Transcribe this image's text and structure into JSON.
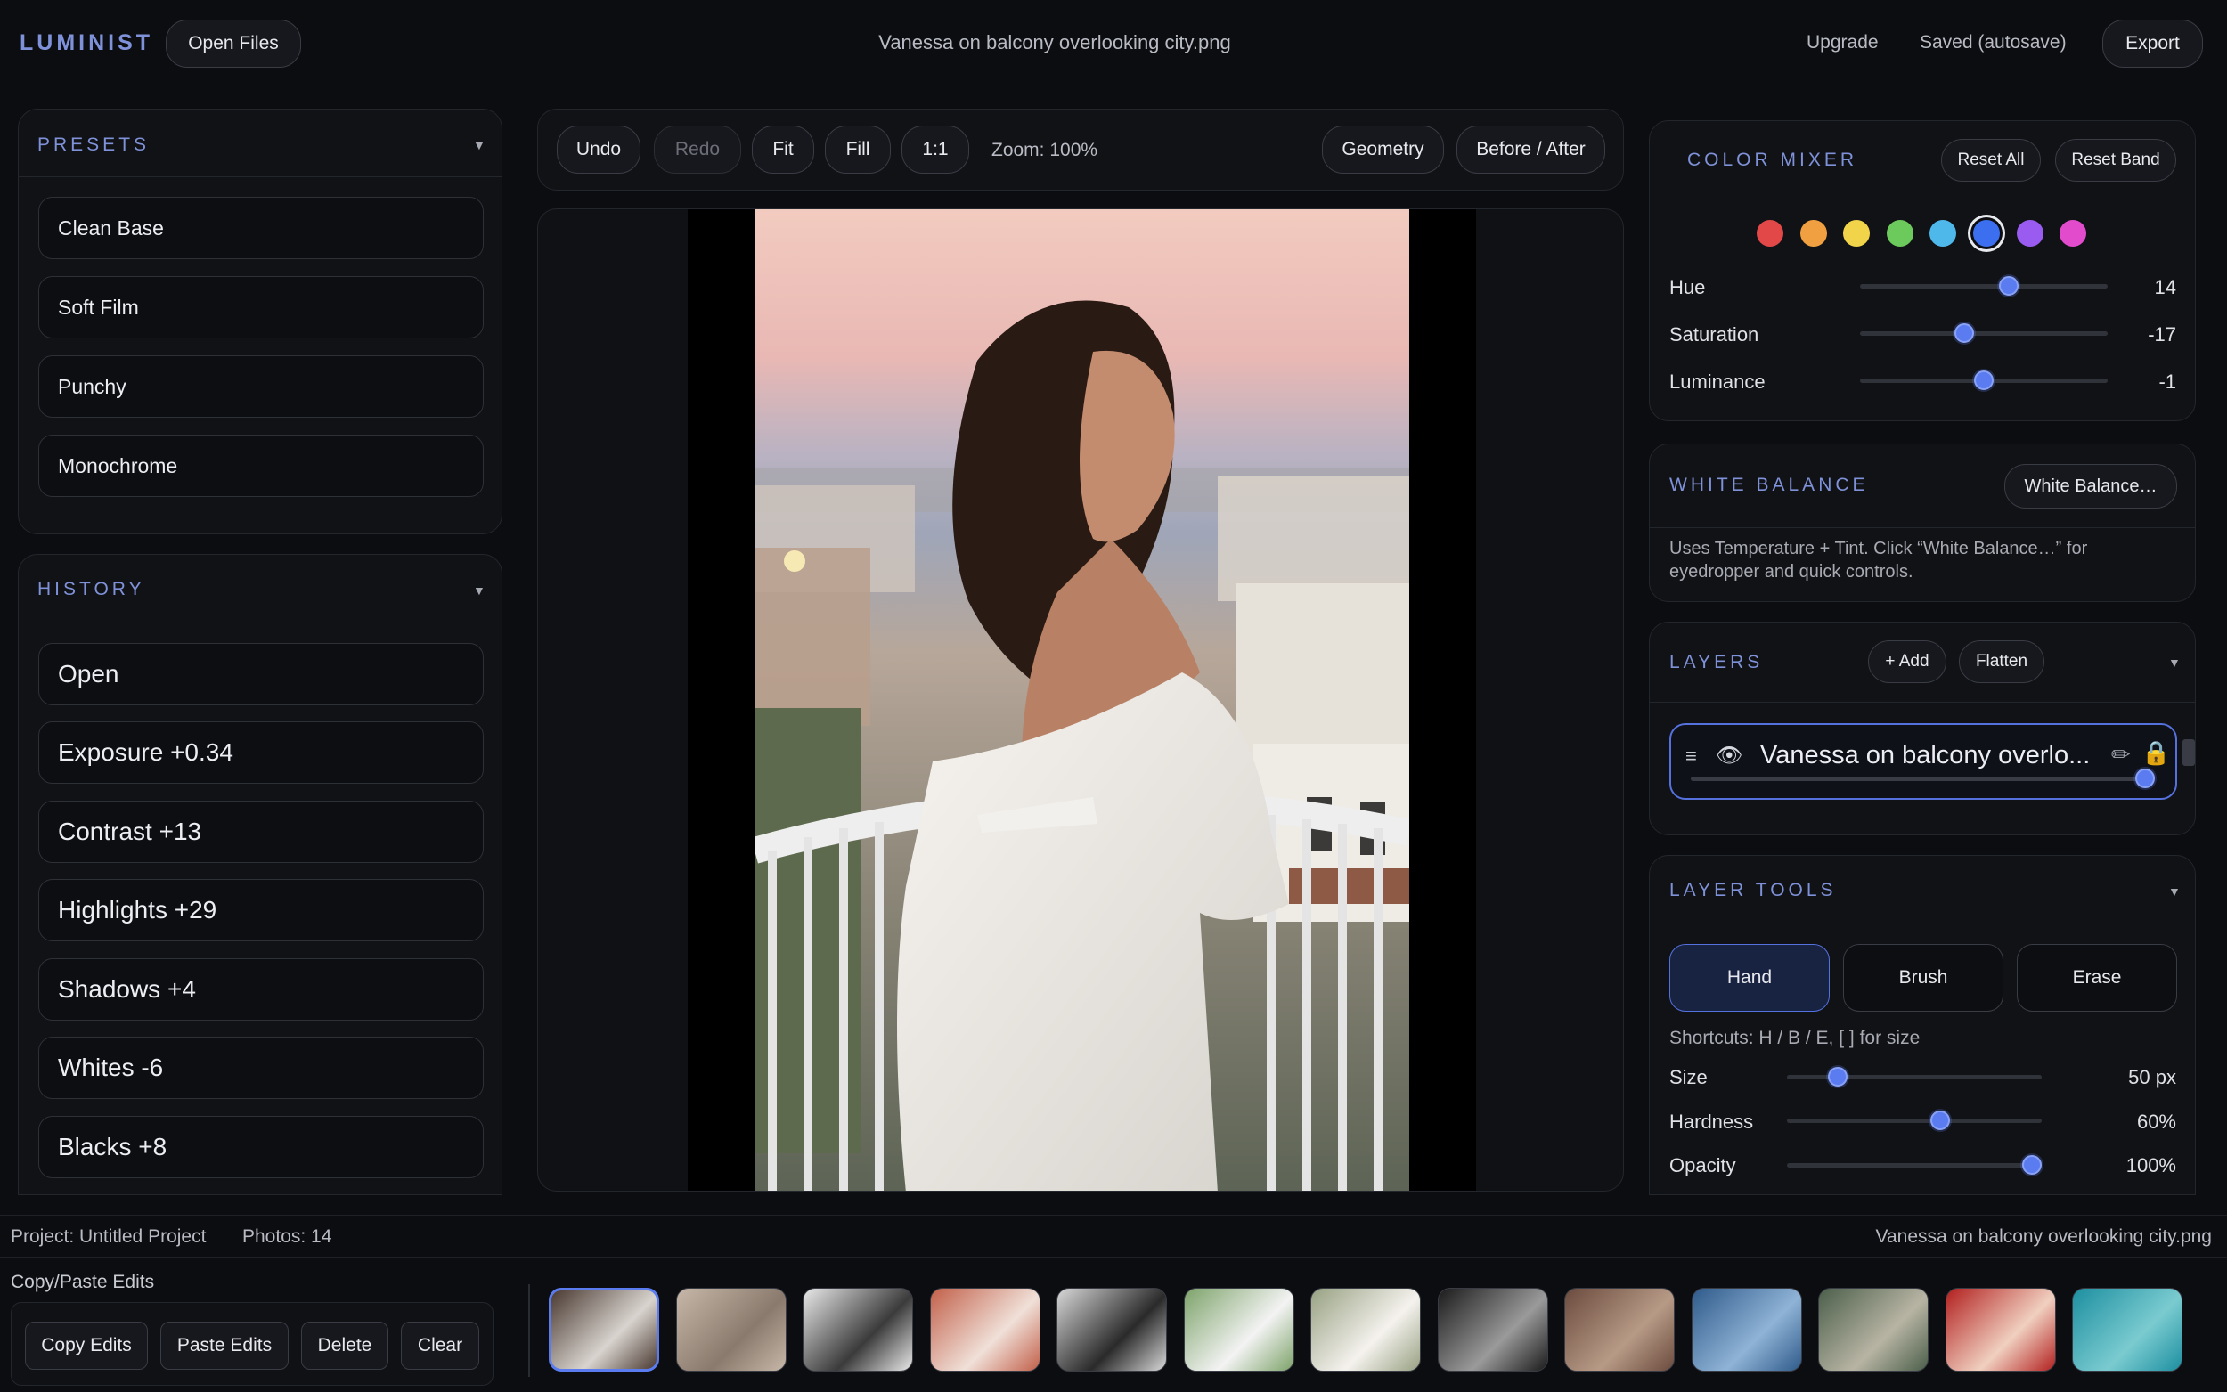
{
  "app": {
    "name": "LUMINIST",
    "open_files": "Open Files",
    "file_title": "Vanessa on balcony overlooking city.png",
    "upgrade": "Upgrade",
    "saved_status": "Saved (autosave)",
    "export": "Export"
  },
  "presets": {
    "title": "PRESETS",
    "items": [
      "Clean Base",
      "Soft Film",
      "Punchy",
      "Monochrome"
    ]
  },
  "history": {
    "title": "HISTORY",
    "items": [
      "Open",
      "Exposure +0.34",
      "Contrast +13",
      "Highlights +29",
      "Shadows +4",
      "Whites -6",
      "Blacks +8"
    ]
  },
  "toolbar": {
    "undo": "Undo",
    "redo": "Redo",
    "fit": "Fit",
    "fill": "Fill",
    "one_to_one": "1:1",
    "zoom": "Zoom: 100%",
    "geometry": "Geometry",
    "before_after": "Before / After"
  },
  "color_mixer": {
    "title": "COLOR MIXER",
    "reset_all": "Reset All",
    "reset_band": "Reset Band",
    "swatches": [
      "#e24848",
      "#f0a040",
      "#f2d44a",
      "#6cc95c",
      "#4fb8ea",
      "#3b6ff0",
      "#9a5cf0",
      "#e24ccc"
    ],
    "selected_swatch": 5,
    "sliders": [
      {
        "label": "Hue",
        "value": "14",
        "level": 0.6
      },
      {
        "label": "Saturation",
        "value": "-17",
        "level": 0.42
      },
      {
        "label": "Luminance",
        "value": "-1",
        "level": 0.5
      }
    ]
  },
  "white_balance": {
    "title": "WHITE BALANCE",
    "button": "White Balance…",
    "description": "Uses Temperature + Tint. Click “White Balance…” for eyedropper and quick controls."
  },
  "layers": {
    "title": "LAYERS",
    "add": "+ Add",
    "flatten": "Flatten",
    "layer_name": "Vanessa on balcony overlo...",
    "opacity_level": 0.98
  },
  "layer_tools": {
    "title": "LAYER TOOLS",
    "tools": [
      "Hand",
      "Brush",
      "Erase"
    ],
    "active_tool": "Hand",
    "shortcuts": "Shortcuts: H / B / E, [ ] for size",
    "sliders": [
      {
        "label": "Size",
        "value": "50 px",
        "level": 0.2
      },
      {
        "label": "Hardness",
        "value": "60%",
        "level": 0.6
      },
      {
        "label": "Opacity",
        "value": "100%",
        "level": 0.96
      }
    ]
  },
  "status_bar": {
    "project": "Project: Untitled Project",
    "photos": "Photos: 14",
    "current_file": "Vanessa on balcony overlooking city.png"
  },
  "copy_paste": {
    "title": "Copy/Paste Edits",
    "copy": "Copy Edits",
    "paste": "Paste Edits",
    "delete": "Delete",
    "clear": "Clear"
  },
  "filmstrip": {
    "selected_index": 0,
    "thumbnails": [
      {
        "icon": "portrait-thumbnail",
        "colors": [
          "#4a3a32",
          "#d9d4cf"
        ]
      },
      {
        "icon": "rings-thumbnail",
        "colors": [
          "#c7b7a8",
          "#8a7a6d"
        ]
      },
      {
        "icon": "bw-dress-thumbnail",
        "colors": [
          "#e9e9e9",
          "#3b3b3b"
        ]
      },
      {
        "icon": "bridal-party-thumbnail",
        "colors": [
          "#c2604a",
          "#f0e0d8"
        ]
      },
      {
        "icon": "bw-hands-thumbnail",
        "colors": [
          "#d8d8d8",
          "#2a2a2a"
        ]
      },
      {
        "icon": "bride-outdoor-thumbnail",
        "colors": [
          "#7da36a",
          "#f3f3f3"
        ]
      },
      {
        "icon": "bouquet-thumbnail",
        "colors": [
          "#97a182",
          "#f5f2ee"
        ]
      },
      {
        "icon": "musician-thumbnail",
        "colors": [
          "#1b1b1b",
          "#9a9a9a"
        ]
      },
      {
        "icon": "building-thumbnail",
        "colors": [
          "#6b4b3e",
          "#b79a86"
        ]
      },
      {
        "icon": "city-river-thumbnail",
        "colors": [
          "#2f5a8a",
          "#8fb3d6"
        ]
      },
      {
        "icon": "city-aerial-thumbnail",
        "colors": [
          "#4b5f4a",
          "#b8b4a4"
        ]
      },
      {
        "icon": "red-car-thumbnail",
        "colors": [
          "#b2201f",
          "#f0d0c0"
        ]
      },
      {
        "icon": "coast-thumbnail",
        "colors": [
          "#1d8fa0",
          "#7acbd0"
        ]
      }
    ]
  }
}
